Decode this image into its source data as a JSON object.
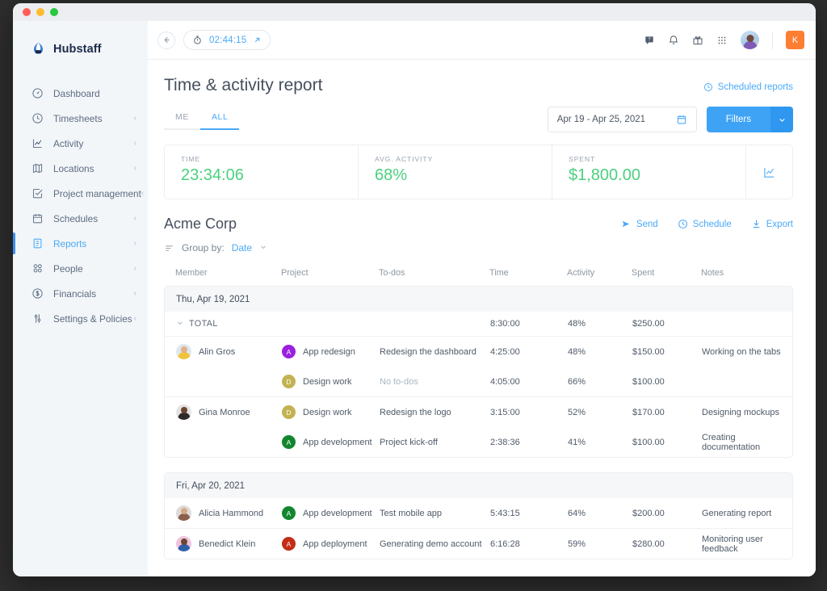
{
  "window": {
    "traffic_lights": [
      "close",
      "minimize",
      "zoom"
    ]
  },
  "sidebar": {
    "brand": "Hubstaff",
    "items": [
      {
        "label": "Dashboard",
        "icon": "gauge-icon",
        "expandable": false,
        "active": false
      },
      {
        "label": "Timesheets",
        "icon": "clock-icon",
        "expandable": true,
        "active": false
      },
      {
        "label": "Activity",
        "icon": "activity-chart-icon",
        "expandable": true,
        "active": false
      },
      {
        "label": "Locations",
        "icon": "map-icon",
        "expandable": true,
        "active": false
      },
      {
        "label": "Project management",
        "icon": "check-square-icon",
        "expandable": true,
        "active": false
      },
      {
        "label": "Schedules",
        "icon": "calendar-icon",
        "expandable": true,
        "active": false
      },
      {
        "label": "Reports",
        "icon": "report-doc-icon",
        "expandable": true,
        "active": true
      },
      {
        "label": "People",
        "icon": "people-icon",
        "expandable": true,
        "active": false
      },
      {
        "label": "Financials",
        "icon": "dollar-circle-icon",
        "expandable": true,
        "active": false
      },
      {
        "label": "Settings & Policies",
        "icon": "sliders-icon",
        "expandable": true,
        "active": false
      }
    ],
    "chevron": "‹"
  },
  "topbar": {
    "back_icon": "arrow-left-icon",
    "timer": {
      "icon": "stopwatch-icon",
      "value": "02:44:15",
      "popout_icon": "external-link-icon"
    },
    "icons": [
      "help-chat-icon",
      "bell-icon",
      "gift-icon",
      "apps-grid-icon"
    ],
    "avatar": "user-avatar",
    "org_badge": "K"
  },
  "page": {
    "title": "Time & activity report",
    "scheduled_reports": {
      "label": "Scheduled reports",
      "icon": "clock-icon"
    },
    "tabs": [
      {
        "label": "ME",
        "active": false
      },
      {
        "label": "ALL",
        "active": true
      }
    ],
    "date_range": {
      "value": "Apr 19 - Apr 25, 2021",
      "icon": "calendar-icon"
    },
    "filters": {
      "label": "Filters",
      "caret": "⌄"
    }
  },
  "stats": {
    "items": [
      {
        "label": "TIME",
        "value": "23:34:06"
      },
      {
        "label": "AVG. ACTIVITY",
        "value": "68%"
      },
      {
        "label": "SPENT",
        "value": "$1,800.00"
      }
    ],
    "chart_toggle_icon": "line-chart-icon",
    "value_color": "#4bd07f"
  },
  "report": {
    "title": "Acme Corp",
    "actions": [
      {
        "label": "Send",
        "icon": "send-icon"
      },
      {
        "label": "Schedule",
        "icon": "clock-icon"
      },
      {
        "label": "Export",
        "icon": "download-icon"
      }
    ],
    "group_by": {
      "icon": "list-lines-icon",
      "label": "Group by:",
      "value": "Date",
      "caret": "⌄"
    },
    "columns": [
      "Member",
      "Project",
      "To-dos",
      "Time",
      "Activity",
      "Spent",
      "Notes"
    ],
    "groups": [
      {
        "date": "Thu, Apr 19, 2021",
        "total": {
          "label": "TOTAL",
          "caret": "⌄",
          "time": "8:30:00",
          "activity": "48%",
          "spent": "$250.00"
        },
        "members": [
          {
            "name": "Alin Gros",
            "avatar_class": "a1",
            "rows": [
              {
                "project": "App redesign",
                "project_initial": "A",
                "project_color": "#9b1fe0",
                "todo": "Redesign the dashboard",
                "todo_muted": false,
                "time": "4:25:00",
                "activity": "48%",
                "spent": "$150.00",
                "notes": "Working on the tabs"
              },
              {
                "project": "Design work",
                "project_initial": "D",
                "project_color": "#c3b252",
                "todo": "No to-dos",
                "todo_muted": true,
                "time": "4:05:00",
                "activity": "66%",
                "spent": "$100.00",
                "notes": ""
              }
            ]
          },
          {
            "name": "Gina Monroe",
            "avatar_class": "a2",
            "rows": [
              {
                "project": "Design work",
                "project_initial": "D",
                "project_color": "#c3b252",
                "todo": "Redesign the logo",
                "todo_muted": false,
                "time": "3:15:00",
                "activity": "52%",
                "spent": "$170.00",
                "notes": "Designing mockups"
              },
              {
                "project": "App development",
                "project_initial": "A",
                "project_color": "#11862f",
                "todo": "Project kick-off",
                "todo_muted": false,
                "time": "2:38:36",
                "activity": "41%",
                "spent": "$100.00",
                "notes": "Creating documentation"
              }
            ]
          }
        ]
      },
      {
        "date": "Fri, Apr 20, 2021",
        "total": null,
        "members": [
          {
            "name": "Alicia Hammond",
            "avatar_class": "a3",
            "rows": [
              {
                "project": "App development",
                "project_initial": "A",
                "project_color": "#11862f",
                "todo": "Test mobile app",
                "todo_muted": false,
                "time": "5:43:15",
                "activity": "64%",
                "spent": "$200.00",
                "notes": "Generating report"
              }
            ]
          },
          {
            "name": "Benedict Klein",
            "avatar_class": "a4",
            "rows": [
              {
                "project": "App deployment",
                "project_initial": "A",
                "project_color": "#c32d16",
                "todo": "Generating demo account",
                "todo_muted": false,
                "time": "6:16:28",
                "activity": "59%",
                "spent": "$280.00",
                "notes": "Monitoring user feedback"
              }
            ]
          }
        ]
      }
    ]
  },
  "colors": {
    "accent": "#4aa9f8",
    "filters_button": "#3fa3f5",
    "success": "#4bd07f",
    "sidebar_bg": "#f3f6f9",
    "org_badge": "#fd7e33"
  }
}
